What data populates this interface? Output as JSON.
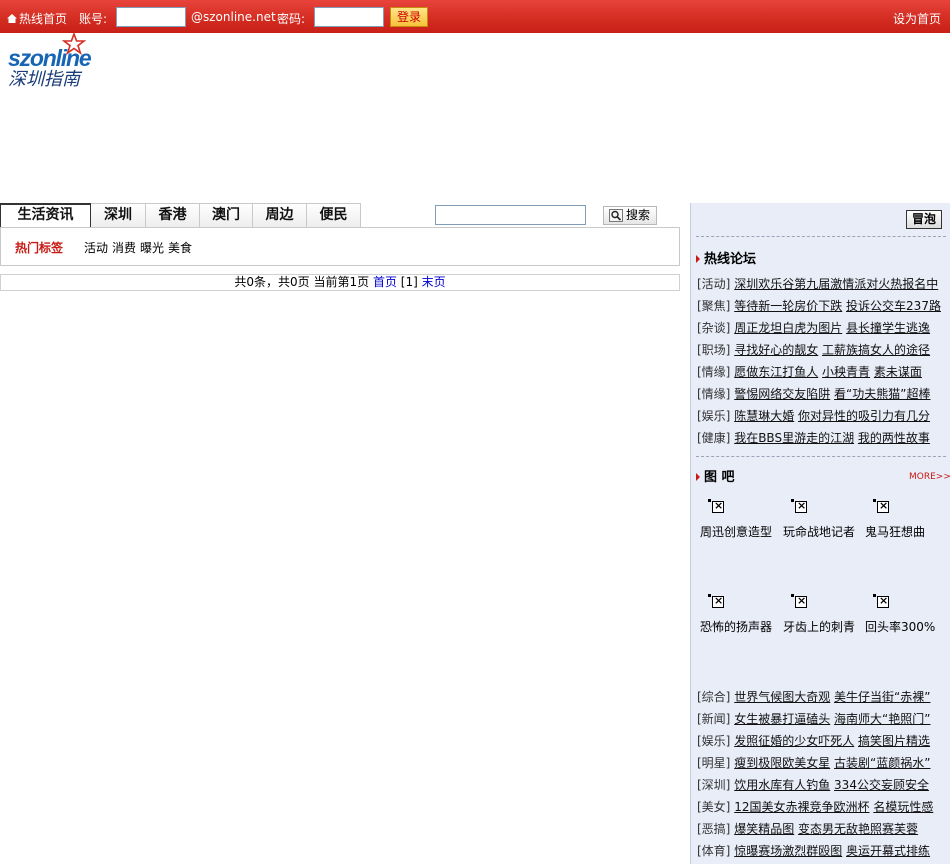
{
  "topbar": {
    "home": "热线首页",
    "account_label": "账号:",
    "account_value": "",
    "domain": "@szonline.net",
    "password_label": "密码:",
    "password_value": "",
    "login": "登录",
    "set_home": "设为首页"
  },
  "logo": {
    "brand": "szonline",
    "brand_cn": "深圳指南"
  },
  "tabs": [
    "生活资讯",
    "深圳",
    "香港",
    "澳门",
    "周边",
    "便民"
  ],
  "search": {
    "value": "",
    "button": "搜索"
  },
  "hot_tags": {
    "label": "热门标签",
    "tags": [
      "活动",
      "消费",
      "曝光",
      "美食"
    ]
  },
  "pager": {
    "summary": "共0条，共0页 当前第1页",
    "first": "首页",
    "current": "[1]",
    "last": "末页"
  },
  "sidebar": {
    "bubble_button": "冒泡",
    "forum": {
      "title": "热线论坛",
      "rows": [
        {
          "cat": "[活动]",
          "links": [
            "深圳欢乐谷第九届激情派对火热报名中"
          ]
        },
        {
          "cat": "[聚焦]",
          "links": [
            "等待新一轮房价下跌",
            "投诉公交车237路"
          ]
        },
        {
          "cat": "[杂谈]",
          "links": [
            "周正龙坦白虎为图片",
            "县长撞学生逃逸"
          ]
        },
        {
          "cat": "[职场]",
          "links": [
            "寻找好心的靓女",
            "工薪族搞女人的途径"
          ]
        },
        {
          "cat": "[情缘]",
          "links": [
            "愿做东江打鱼人",
            "小秧青青",
            "素未谋面"
          ]
        },
        {
          "cat": "[情缘]",
          "links": [
            "警惕网络交友陷阱",
            "看“功夫熊猫”超棒"
          ]
        },
        {
          "cat": "[娱乐]",
          "links": [
            "陈慧琳大婚",
            "你对异性的吸引力有几分"
          ]
        },
        {
          "cat": "[健康]",
          "links": [
            "我在BBS里游走的江湖",
            "我的两性故事"
          ]
        }
      ]
    },
    "gallery": {
      "title": "图 吧",
      "more": "MORE>>",
      "items": [
        "周迅创意造型",
        "玩命战地记者",
        "鬼马狂想曲",
        "恐怖的扬声器",
        "牙齿上的刺青",
        "回头率300%"
      ]
    },
    "news": {
      "rows": [
        {
          "cat": "[综合]",
          "links": [
            "世界气候图大奇观",
            "美牛仔当街“赤裸”"
          ]
        },
        {
          "cat": "[新闻]",
          "links": [
            "女生被暴打逼磕头",
            "海南师大“艳照门”"
          ]
        },
        {
          "cat": "[娱乐]",
          "links": [
            "发照征婚的少女吓死人",
            "搞笑图片精选"
          ]
        },
        {
          "cat": "[明星]",
          "links": [
            "瘦到极限欧美女星",
            "古装剧“蓝颜祸水”"
          ]
        },
        {
          "cat": "[深圳]",
          "links": [
            "饮用水库有人钓鱼",
            "334公交妄顾安全"
          ]
        },
        {
          "cat": "[美女]",
          "links": [
            "12国美女赤裸竞争欧洲杯",
            "名模玩性感"
          ]
        },
        {
          "cat": "[恶搞]",
          "links": [
            "爆笑精品图",
            "变态男无敌艳照赛芙蓉"
          ]
        },
        {
          "cat": "[体育]",
          "links": [
            "惊曝赛场激烈群殴图",
            "奥运开幕式排练"
          ]
        }
      ]
    }
  },
  "colors": {
    "topbar_red": "#d42d22",
    "accent_red": "#c81a14",
    "panel_bg": "#e9edf8",
    "link_blue": "#0000cc"
  }
}
